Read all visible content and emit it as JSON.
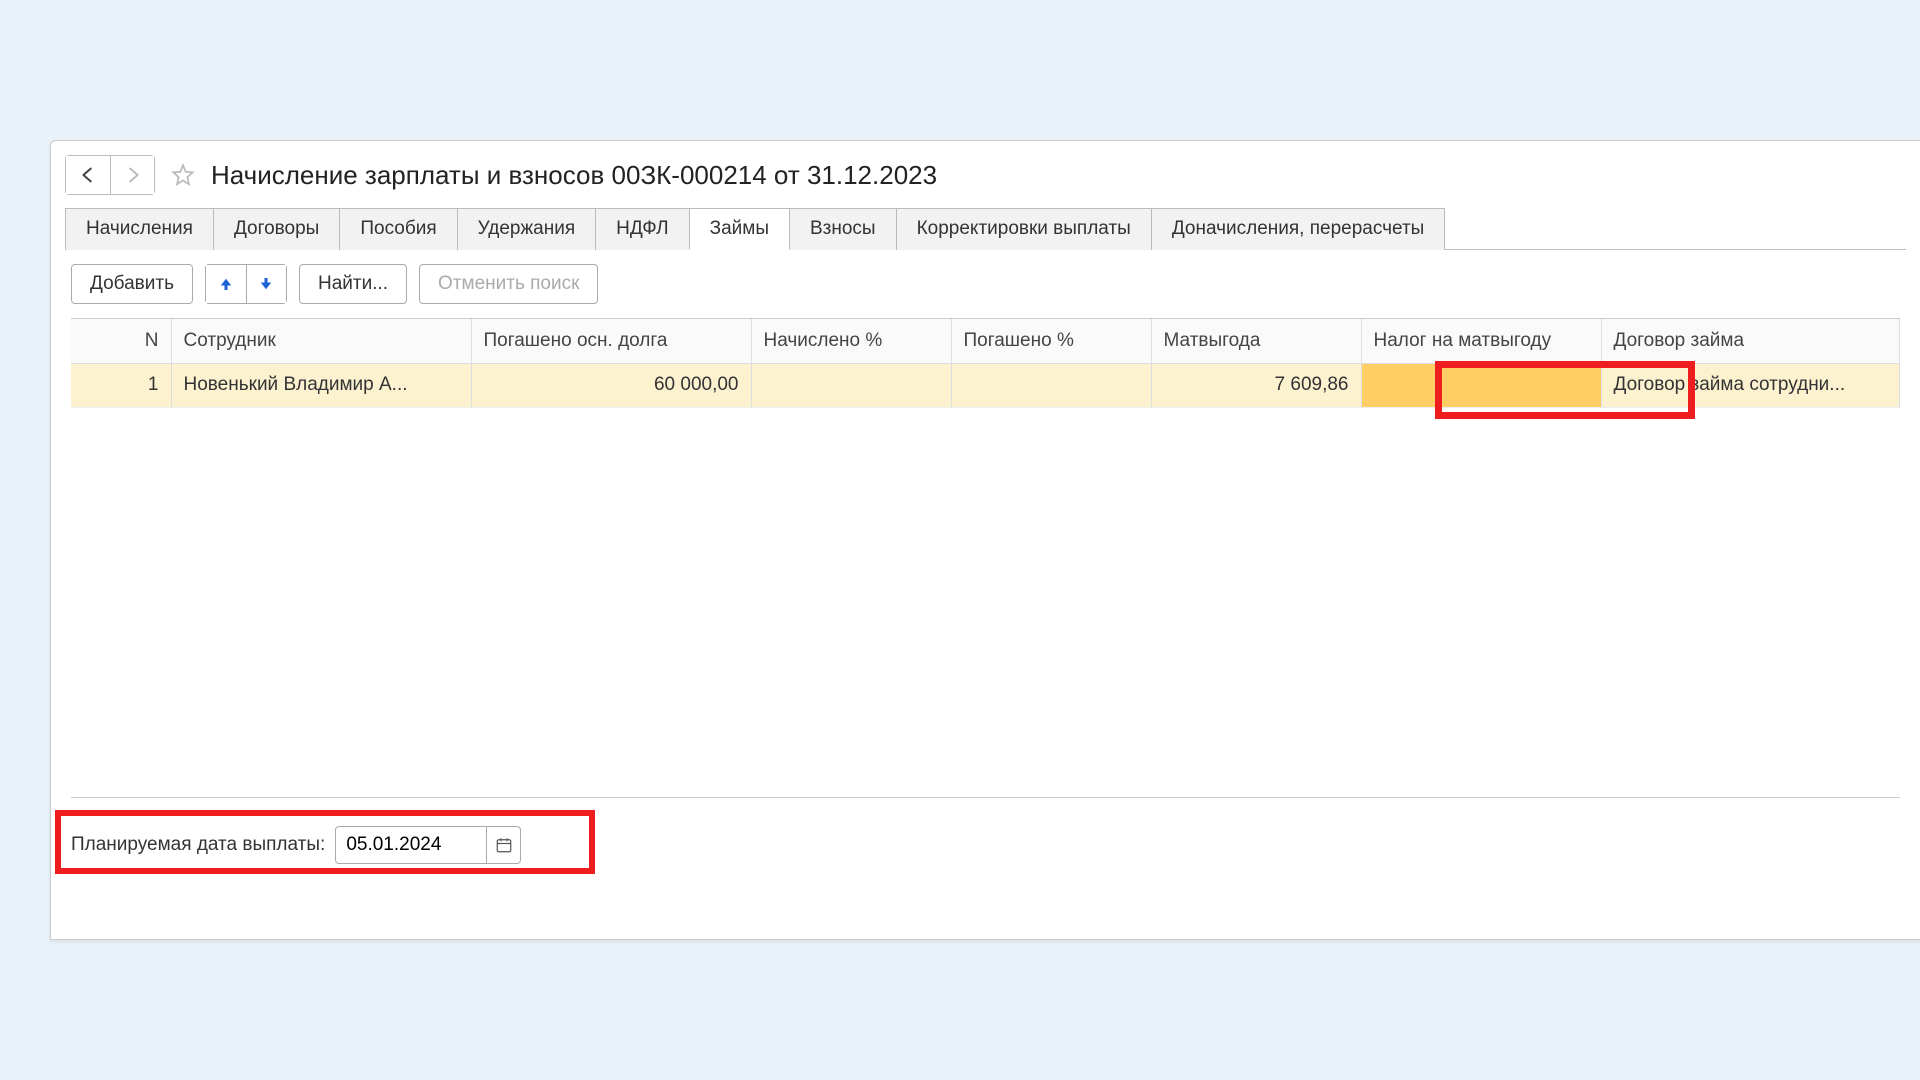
{
  "header": {
    "title": "Начисление зарплаты и взносов 00ЗК-000214 от 31.12.2023"
  },
  "tabs": [
    {
      "label": "Начисления",
      "active": false
    },
    {
      "label": "Договоры",
      "active": false
    },
    {
      "label": "Пособия",
      "active": false
    },
    {
      "label": "Удержания",
      "active": false
    },
    {
      "label": "НДФЛ",
      "active": false
    },
    {
      "label": "Займы",
      "active": true
    },
    {
      "label": "Взносы",
      "active": false
    },
    {
      "label": "Корректировки выплаты",
      "active": false
    },
    {
      "label": "Доначисления, перерасчеты",
      "active": false
    }
  ],
  "toolbar": {
    "add_label": "Добавить",
    "find_label": "Найти...",
    "cancel_search_label": "Отменить поиск"
  },
  "table": {
    "columns": {
      "n": "N",
      "employee": "Сотрудник",
      "paid_principal": "Погашено осн. долга",
      "accrued_pct": "Начислено %",
      "paid_pct": "Погашено %",
      "mat_benefit": "Матвыгода",
      "tax_mat_benefit": "Налог на матвыгоду",
      "contract": "Договор займа"
    },
    "rows": [
      {
        "n": "1",
        "employee": "Новенький Владимир А...",
        "paid_principal": "60 000,00",
        "accrued_pct": "",
        "paid_pct": "",
        "mat_benefit": "7 609,86",
        "tax_mat_benefit": "",
        "contract": "Договор займа сотрудни..."
      }
    ]
  },
  "footer": {
    "planned_date_label": "Планируемая дата выплаты:",
    "planned_date_value": "05.01.2024"
  }
}
